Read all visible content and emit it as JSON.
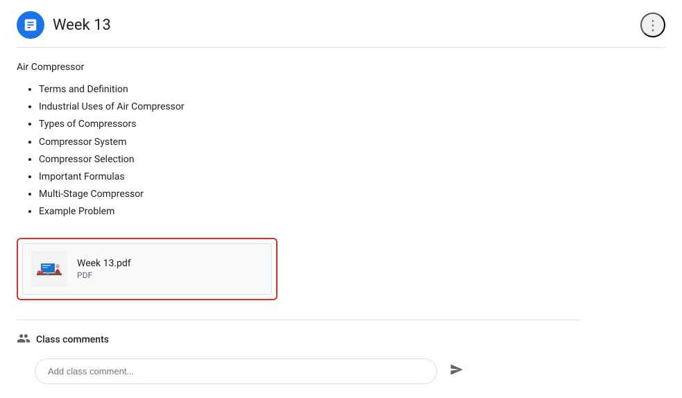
{
  "header": {
    "title": "Week 13",
    "more_vert_label": "⋮"
  },
  "app_icon": {
    "symbol": "🗒",
    "unicode": "☰"
  },
  "content": {
    "section_title": "Air Compressor",
    "bullet_items": [
      "Terms and Definition",
      "Industrial Uses of Air Compressor",
      "Types of Compressors",
      "Compressor System",
      "Compressor Selection",
      "Important Formulas",
      "Multi-Stage Compressor",
      "Example Problem"
    ],
    "attachment": {
      "filename": "Week 13.pdf",
      "type": "PDF"
    }
  },
  "comments": {
    "label": "Class comments",
    "placeholder": "Add class comment..."
  }
}
